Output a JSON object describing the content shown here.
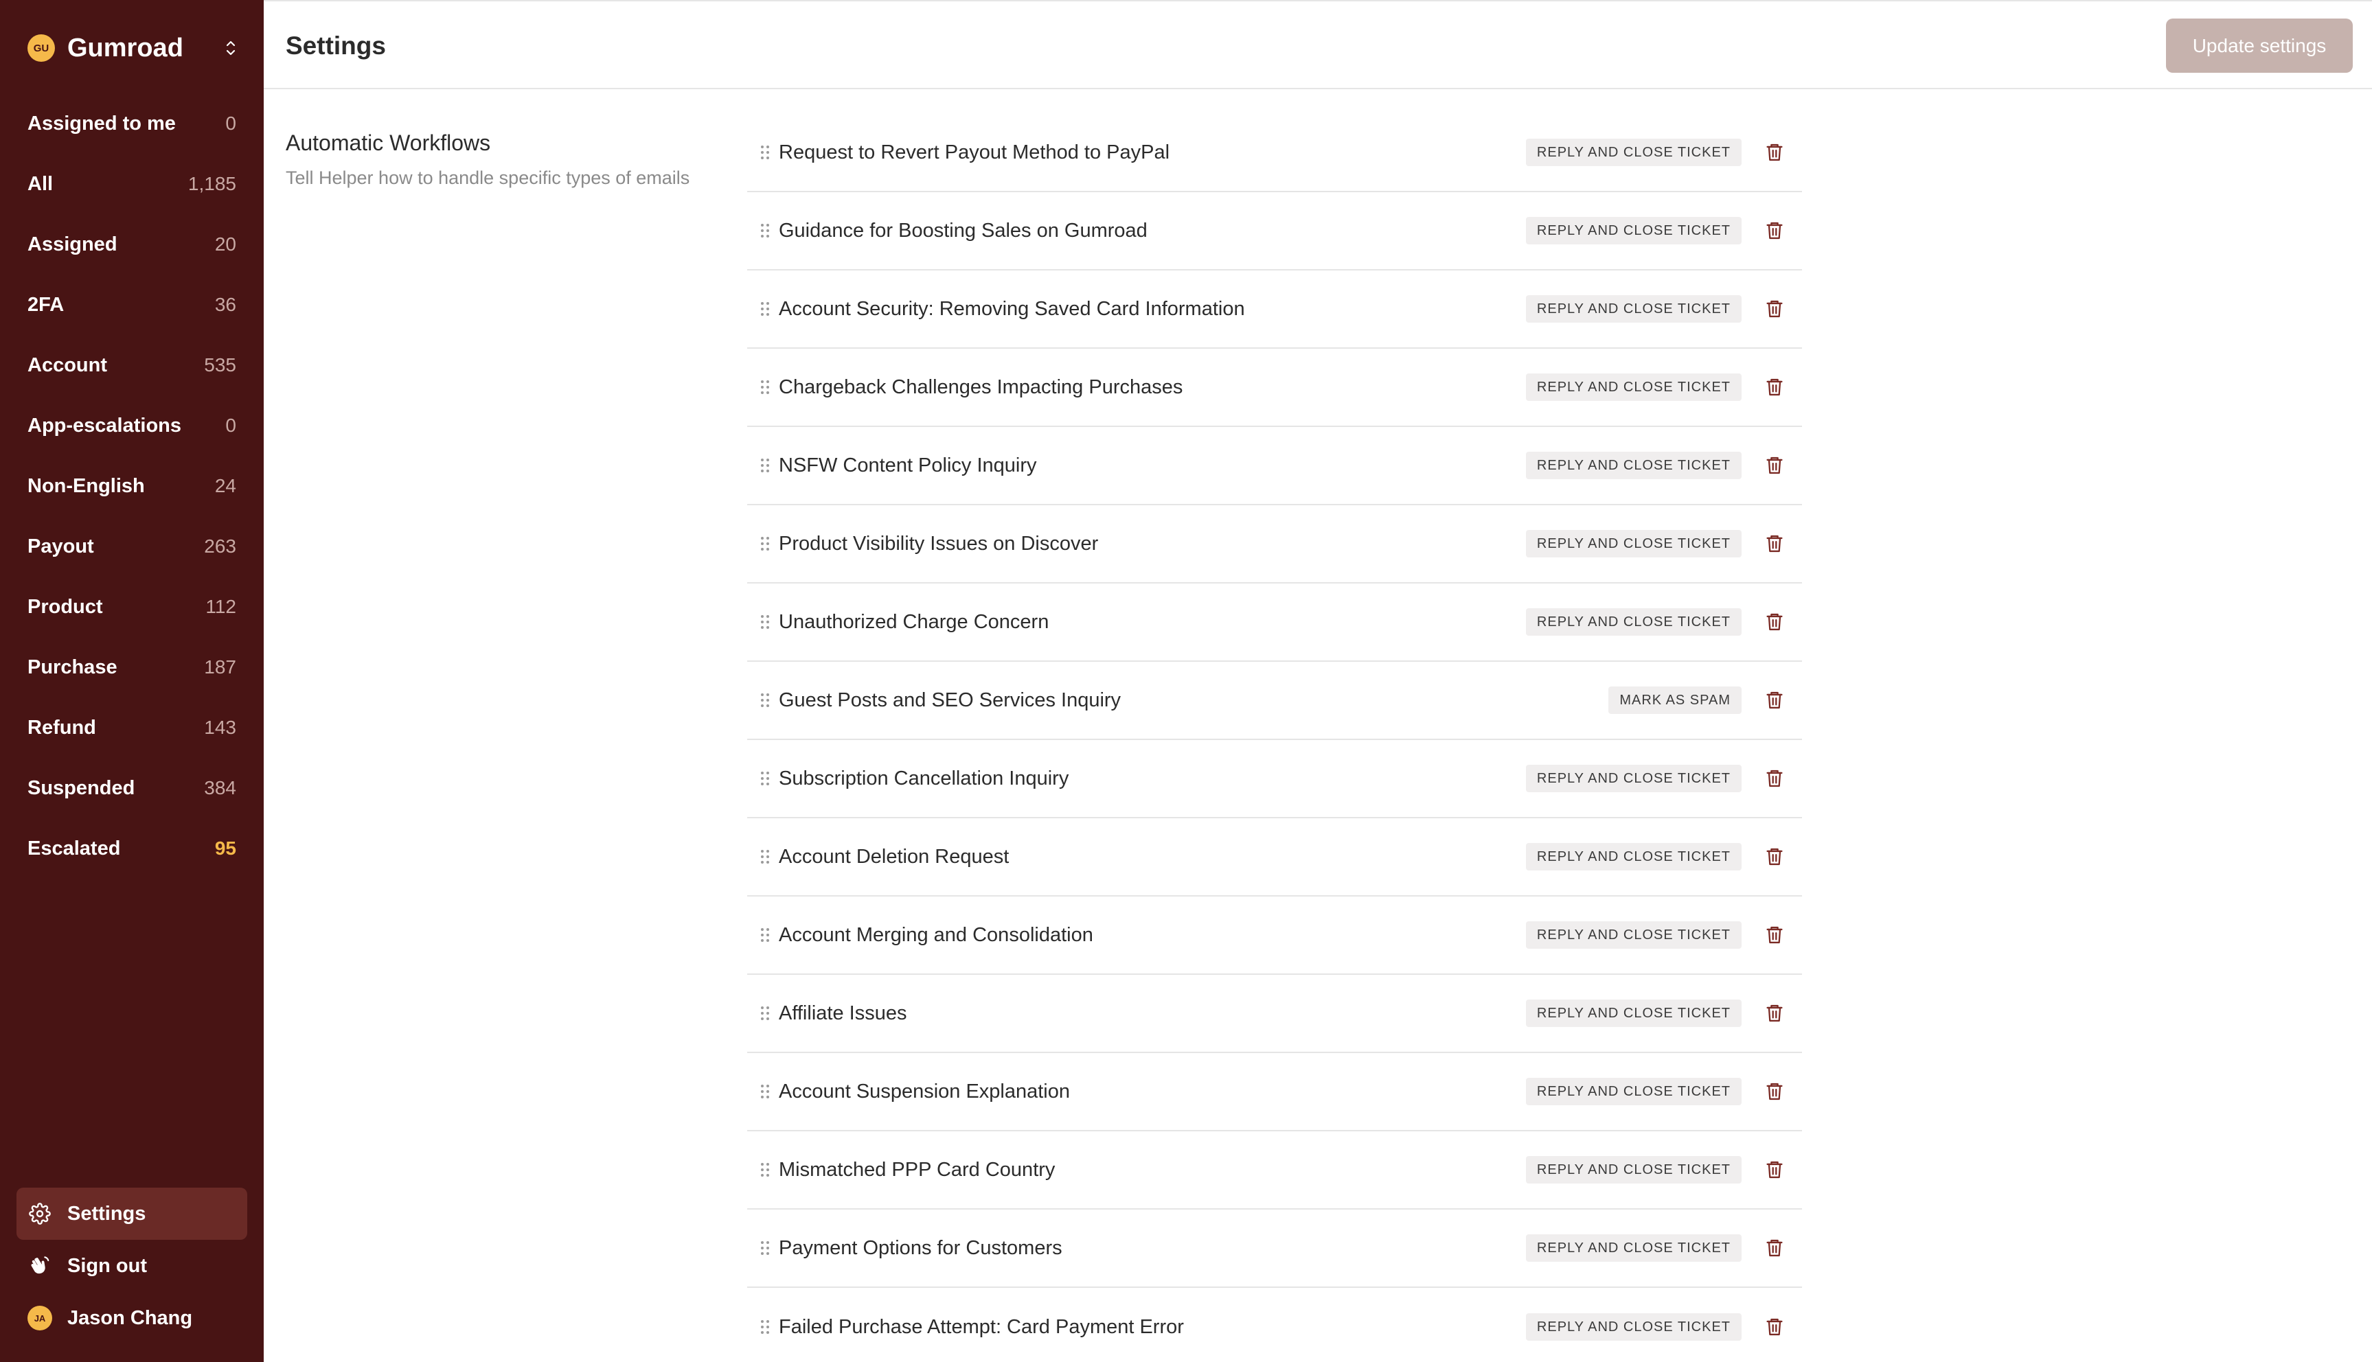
{
  "sidebar": {
    "brand": {
      "avatar": "GU",
      "name": "Gumroad",
      "switch_icon": "chevron-up-down-icon"
    },
    "nav": [
      {
        "label": "Assigned to me",
        "count": "0"
      },
      {
        "label": "All",
        "count": "1,185"
      },
      {
        "label": "Assigned",
        "count": "20"
      },
      {
        "label": "2FA",
        "count": "36"
      },
      {
        "label": "Account",
        "count": "535"
      },
      {
        "label": "App-escalations",
        "count": "0"
      },
      {
        "label": "Non-English",
        "count": "24"
      },
      {
        "label": "Payout",
        "count": "263"
      },
      {
        "label": "Product",
        "count": "112"
      },
      {
        "label": "Purchase",
        "count": "187"
      },
      {
        "label": "Refund",
        "count": "143"
      },
      {
        "label": "Suspended",
        "count": "384"
      },
      {
        "label": "Escalated",
        "count": "95",
        "accent_color": "#f5b94a"
      }
    ],
    "settings_label": "Settings",
    "signout_label": "Sign out",
    "user": {
      "avatar": "JA",
      "name": "Jason Chang"
    }
  },
  "header": {
    "title": "Settings",
    "update_button": "Update settings"
  },
  "section": {
    "title": "Automatic Workflows",
    "description": "Tell Helper how to handle specific types of emails"
  },
  "workflows": [
    {
      "title": "Request to Revert Payout Method to PayPal",
      "action": "REPLY AND CLOSE TICKET"
    },
    {
      "title": "Guidance for Boosting Sales on Gumroad",
      "action": "REPLY AND CLOSE TICKET"
    },
    {
      "title": "Account Security: Removing Saved Card Information",
      "action": "REPLY AND CLOSE TICKET"
    },
    {
      "title": "Chargeback Challenges Impacting Purchases",
      "action": "REPLY AND CLOSE TICKET"
    },
    {
      "title": "NSFW Content Policy Inquiry",
      "action": "REPLY AND CLOSE TICKET"
    },
    {
      "title": "Product Visibility Issues on Discover",
      "action": "REPLY AND CLOSE TICKET"
    },
    {
      "title": "Unauthorized Charge Concern",
      "action": "REPLY AND CLOSE TICKET"
    },
    {
      "title": "Guest Posts and SEO Services Inquiry",
      "action": "MARK AS SPAM"
    },
    {
      "title": "Subscription Cancellation Inquiry",
      "action": "REPLY AND CLOSE TICKET"
    },
    {
      "title": "Account Deletion Request",
      "action": "REPLY AND CLOSE TICKET"
    },
    {
      "title": "Account Merging and Consolidation",
      "action": "REPLY AND CLOSE TICKET"
    },
    {
      "title": "Affiliate Issues",
      "action": "REPLY AND CLOSE TICKET"
    },
    {
      "title": "Account Suspension Explanation",
      "action": "REPLY AND CLOSE TICKET"
    },
    {
      "title": "Mismatched PPP Card Country",
      "action": "REPLY AND CLOSE TICKET"
    },
    {
      "title": "Payment Options for Customers",
      "action": "REPLY AND CLOSE TICKET"
    },
    {
      "title": "Failed Purchase Attempt: Card Payment Error",
      "action": "REPLY AND CLOSE TICKET"
    }
  ],
  "colors": {
    "sidebar_bg": "#481414",
    "accent": "#f5b94a",
    "trash_icon": "#7a2a24",
    "update_button_bg": "#c6b2ad"
  }
}
